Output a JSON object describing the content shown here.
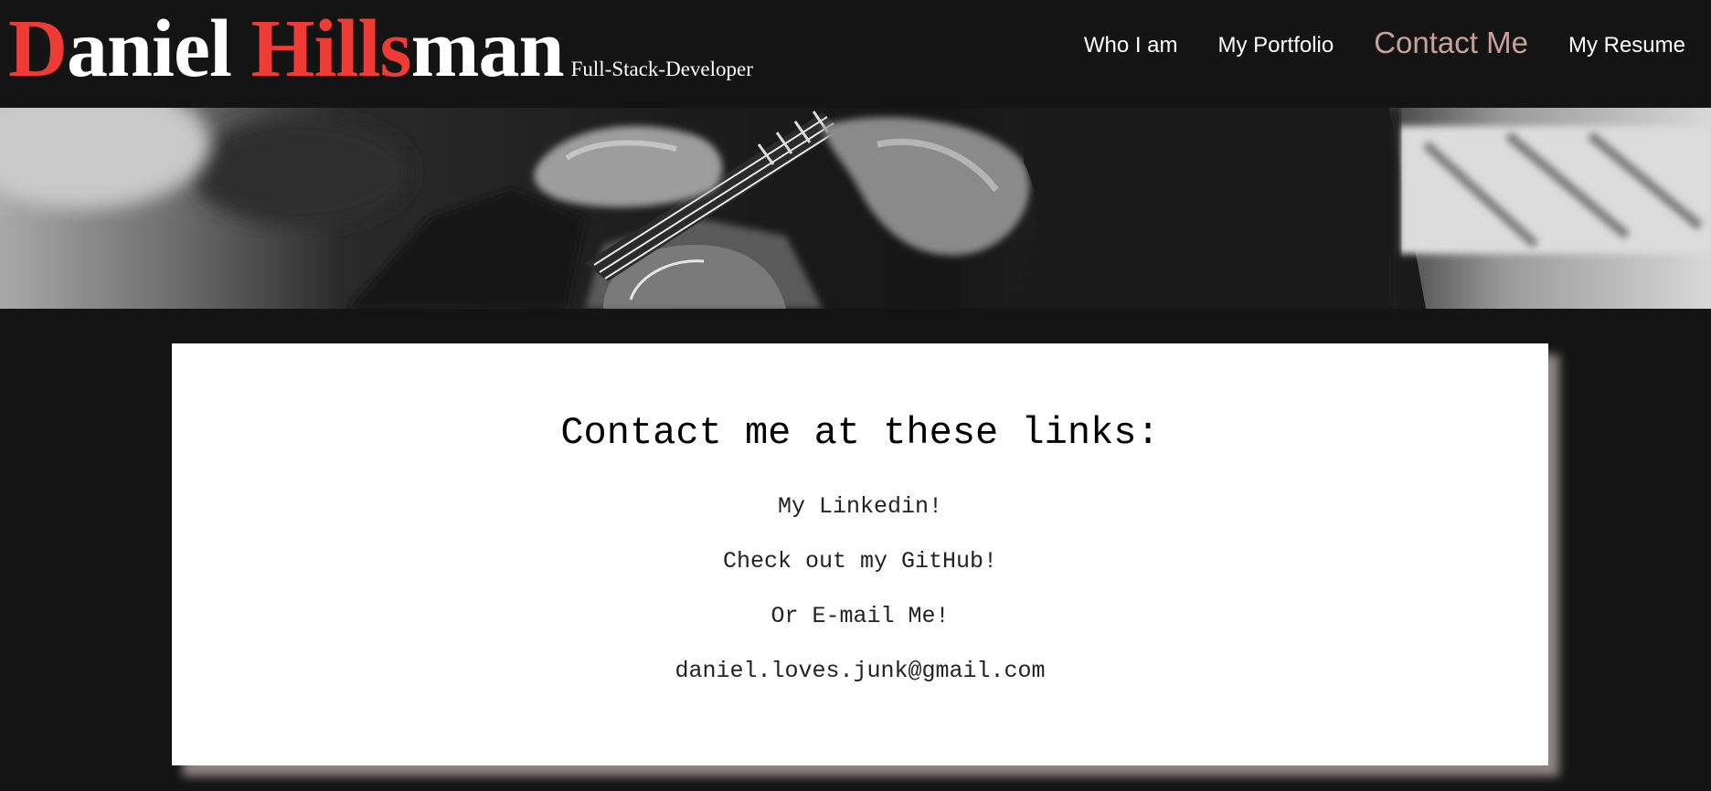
{
  "brand": {
    "first_initial": "D",
    "first_rest": "aniel ",
    "last_initial": "Hills",
    "last_rest": "man",
    "tagline": "Full-Stack-Developer"
  },
  "nav": {
    "items": [
      {
        "label": "Who I am"
      },
      {
        "label": "My Portfolio"
      },
      {
        "label": "Contact Me",
        "active": true
      },
      {
        "label": "My Resume"
      }
    ]
  },
  "colors": {
    "accent_red": "#ef3b36",
    "active_nav": "#c9a19c",
    "background": "#141414",
    "card_shadow": "#8e8686"
  },
  "contact": {
    "title": "Contact me at these links:",
    "linkedin": "My Linkedin!",
    "github": "Check out my GitHub!",
    "email_prompt": "Or E-mail Me!",
    "email": "daniel.loves.junk@gmail.com"
  }
}
